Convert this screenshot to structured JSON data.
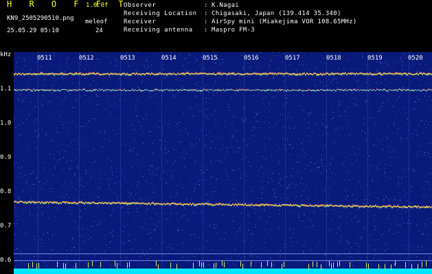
{
  "header": {
    "logo": "H R O F F T",
    "version": "1.0.0f",
    "filename": "KN9_2505290510.png",
    "mode": "meleof",
    "datetime": "25.05.29 05:10",
    "count": "24",
    "info": [
      {
        "label": "Observer",
        "value": "K.Nagai"
      },
      {
        "label": "Receiving Location",
        "value": "Chigasaki, Japan (139.414 35.340)"
      },
      {
        "label": "Receiver",
        "value": "AirSpy mini (Miakejima VOR 108.65MHz)"
      },
      {
        "label": "Receiving antenna",
        "value": "Maspro FM-3"
      }
    ]
  },
  "axis": {
    "unit": "kHz",
    "y_ticks": [
      "1.1",
      "1.0",
      "0.9",
      "0.8",
      "0.7",
      "0.6"
    ],
    "x_ticks": [
      "0511",
      "0512",
      "0513",
      "0514",
      "0515",
      "0516",
      "0517",
      "0518",
      "0519",
      "0520"
    ]
  },
  "colors": {
    "background": "#0a1a7a",
    "noise_light": "#6f8cff",
    "line": "#ffdd55",
    "baseline": "#00e5ff"
  }
}
